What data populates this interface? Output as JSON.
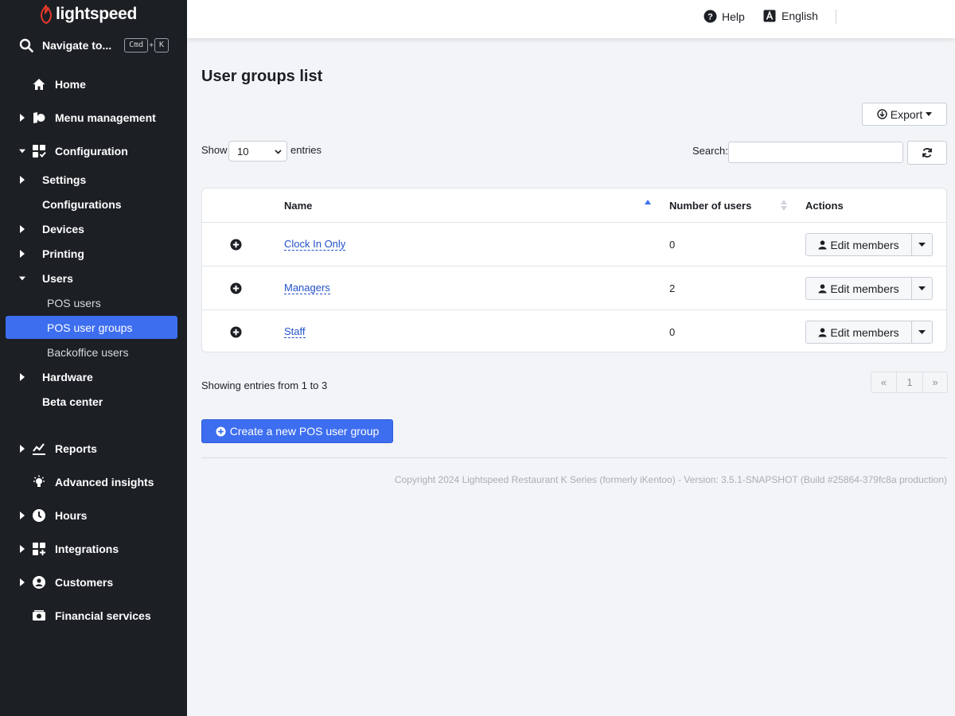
{
  "brand": {
    "name": "lightspeed",
    "accent": "#e83a2b",
    "primary": "#3d6ef0"
  },
  "sidebar": {
    "search": {
      "label": "Navigate to...",
      "shortcut_mod": "Cmd",
      "shortcut_plus": "+",
      "shortcut_key": "K"
    },
    "items": [
      {
        "label": "Home",
        "icon": "home-icon"
      },
      {
        "label": "Menu management",
        "icon": "menu-management-icon"
      },
      {
        "label": "Configuration",
        "icon": "configuration-icon"
      },
      {
        "label": "Settings"
      },
      {
        "label": "Configurations"
      },
      {
        "label": "Devices"
      },
      {
        "label": "Printing"
      },
      {
        "label": "Users"
      },
      {
        "label": "POS users"
      },
      {
        "label": "POS user groups"
      },
      {
        "label": "Backoffice users"
      },
      {
        "label": "Hardware"
      },
      {
        "label": "Beta center"
      },
      {
        "label": "Reports",
        "icon": "reports-icon"
      },
      {
        "label": "Advanced insights",
        "icon": "lightbulb-icon"
      },
      {
        "label": "Hours",
        "icon": "clock-icon"
      },
      {
        "label": "Integrations",
        "icon": "integrations-icon"
      },
      {
        "label": "Customers",
        "icon": "customers-icon"
      },
      {
        "label": "Financial services",
        "icon": "financial-services-icon"
      }
    ],
    "active": "POS user groups"
  },
  "topbar": {
    "help_label": "Help",
    "language_label": "English"
  },
  "main": {
    "title": "User groups list",
    "export_label": "Export",
    "show_label": "Show",
    "page_size": "10",
    "entries_label": "entries",
    "search_label": "Search:",
    "search_value": "",
    "columns": {
      "name": "Name",
      "users": "Number of users",
      "actions": "Actions"
    },
    "rows": [
      {
        "name": "Clock In Only",
        "users": "0",
        "action": "Edit members"
      },
      {
        "name": "Managers",
        "users": "2",
        "action": "Edit members"
      },
      {
        "name": "Staff",
        "users": "0",
        "action": "Edit members"
      }
    ],
    "showing": "Showing entries from 1 to 3",
    "pager": {
      "prev": "«",
      "page": "1",
      "next": "»"
    },
    "create_label": "Create a new POS user group",
    "copyright": "Copyright 2024 Lightspeed Restaurant K Series (formerly iKentoo) - Version: 3.5.1-SNAPSHOT (Build #25864-379fc8a production)"
  }
}
